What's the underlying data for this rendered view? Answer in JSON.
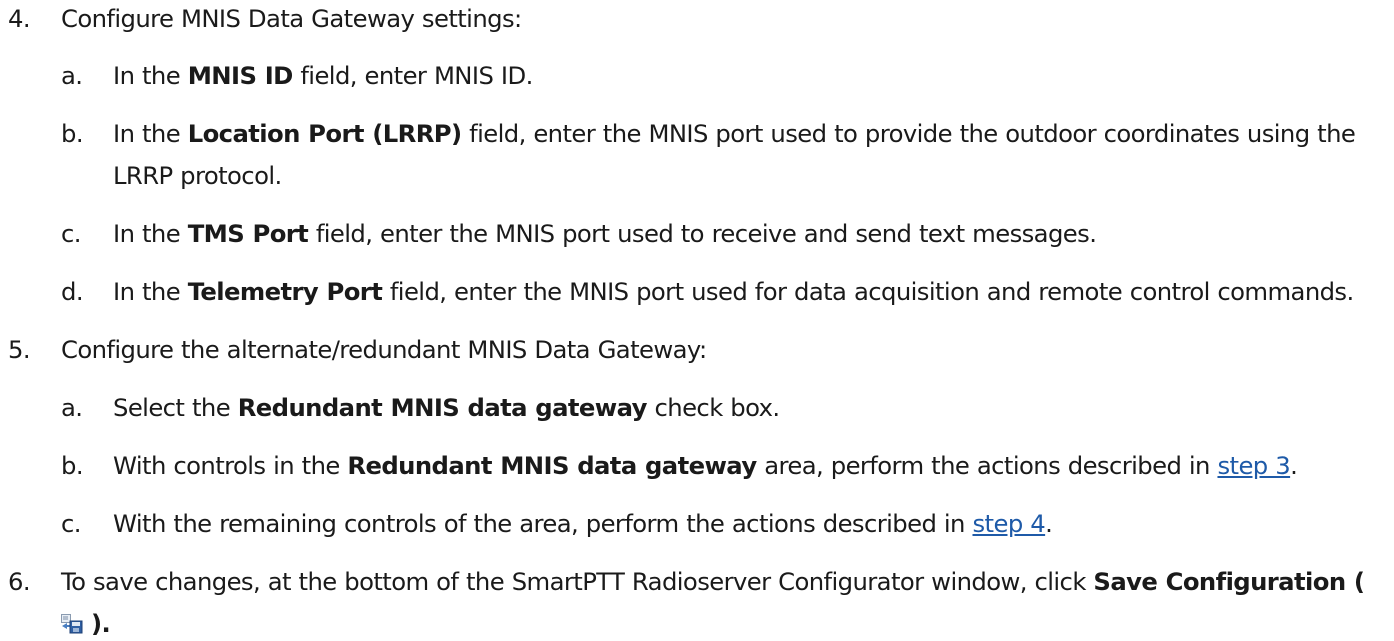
{
  "step4": {
    "number": "4.",
    "text": "Configure MNIS Data Gateway settings:",
    "items": [
      {
        "letter": "a.",
        "pre": "In the ",
        "bold": "MNIS ID",
        "post": " field, enter MNIS ID."
      },
      {
        "letter": "b.",
        "pre": "In the ",
        "bold": "Location Port (LRRP)",
        "post": " field, enter the MNIS port used to provide the outdoor coordinates using the",
        "cont": "LRRP protocol."
      },
      {
        "letter": "c.",
        "pre": "In the ",
        "bold": "TMS Port",
        "post": " field, enter the MNIS port used to receive and send text messages."
      },
      {
        "letter": "d.",
        "pre": "In the ",
        "bold": "Telemetry Port",
        "post": " field, enter the MNIS port used for data acquisition and remote control commands."
      }
    ]
  },
  "step5": {
    "number": "5.",
    "text": "Configure the alternate/redundant MNIS Data Gateway:",
    "items": [
      {
        "letter": "a.",
        "pre": "Select the ",
        "bold": "Redundant MNIS data gateway",
        "post": " check box."
      },
      {
        "letter": "b.",
        "pre": "With controls in the ",
        "bold": "Redundant MNIS data gateway",
        "post": " area, perform the actions described in ",
        "link": "step 3",
        "end": "."
      },
      {
        "letter": "c.",
        "pre": "With the remaining controls of the area, perform the actions described in ",
        "link": "step 4",
        "end": "."
      }
    ]
  },
  "step6": {
    "number": "6.",
    "pre": "To save changes, at the bottom of the SmartPTT Radioserver Configurator window, click ",
    "bold": "Save Configuration (",
    "icon": "save-icon",
    "bold_end": ")."
  },
  "colors": {
    "text": "#1a1a1a",
    "link": "#1e5aa8"
  }
}
